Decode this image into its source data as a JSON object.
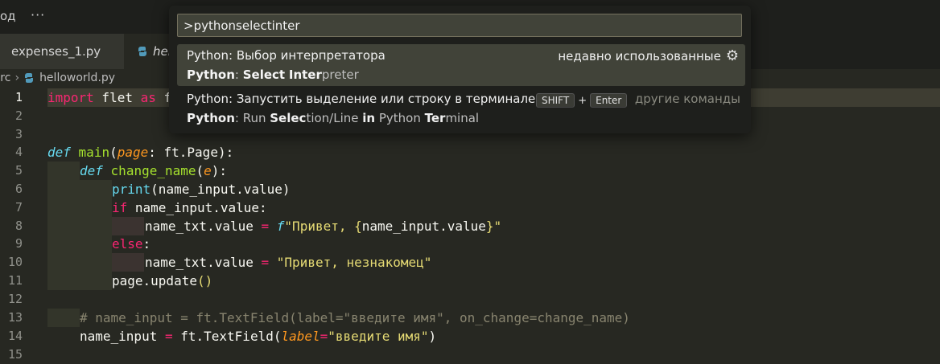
{
  "menubar": {
    "partial_label": "од",
    "more": "···"
  },
  "tabs": [
    {
      "label": "expenses_1.py"
    },
    {
      "label": "hel"
    }
  ],
  "breadcrumb": {
    "folder": "src",
    "file": "helloworld.py"
  },
  "editor": {
    "lines": [
      {
        "n": "1"
      },
      {
        "n": "2"
      },
      {
        "n": "3"
      },
      {
        "n": "4"
      },
      {
        "n": "5"
      },
      {
        "n": "6"
      },
      {
        "n": "7"
      },
      {
        "n": "8"
      },
      {
        "n": "9"
      },
      {
        "n": "10"
      },
      {
        "n": "11"
      },
      {
        "n": "12"
      },
      {
        "n": "13"
      },
      {
        "n": "14"
      },
      {
        "n": "15"
      }
    ],
    "tokens": {
      "l1_import": "import",
      "l1_flet": " flet ",
      "l1_as": "as",
      "l1_rest": " f",
      "l4_def": "def",
      "l4_main": "main",
      "l4_p1": "(",
      "l4_page": "page",
      "l4_p2": ": ft.Page):",
      "l5_def": "def",
      "l5_fn": "change_name",
      "l5_p1": "(",
      "l5_e": "e",
      "l5_p2": "):",
      "l6_print": "print",
      "l6_rest": "(name_input.value)",
      "l7_if": "if",
      "l7_rest": " name_input.value:",
      "l8_a": "name_txt.value ",
      "l8_eq": "=",
      "l8_sp": " ",
      "l8_f": "f",
      "l8_s1": "\"Привет, ",
      "l8_b1": "{",
      "l8_mid": "name_input.value",
      "l8_b2": "}",
      "l8_s2": "\"",
      "l9_else": "else",
      "l9_colon": ":",
      "l10_a": "name_txt.value ",
      "l10_eq": "=",
      "l10_sp": " ",
      "l10_str": "\"Привет, незнакомец\"",
      "l11_a": "page.update",
      "l11_b": "()",
      "l13_comment": "# name_input = ft.TextField(label=\"введите имя\", on_change=change_name)",
      "l14_a": "name_input ",
      "l14_eq": "=",
      "l14_b": " ft.TextField(",
      "l14_label": "label",
      "l14_eq2": "=",
      "l14_str": "\"введите имя\"",
      "l14_c": ")"
    }
  },
  "palette": {
    "input_value": ">pythonselectinter",
    "items": [
      {
        "title": "Python: Выбор интерпретатора",
        "right": "недавно использованные",
        "sub_parts": [
          "Python",
          ": ",
          "Select",
          " ",
          "Inter",
          "preter"
        ]
      },
      {
        "title": "Python: Запустить выделение или строку в терминале ...",
        "keys": [
          "SHIFT",
          "+",
          "Enter"
        ],
        "right": "другие команды",
        "sub_parts": [
          "Python",
          ": Run ",
          "Selec",
          "tion/Line ",
          "in",
          " Python ",
          "Ter",
          "minal"
        ]
      }
    ]
  },
  "icons": {
    "python": "python-file-icon",
    "gear": "gear-icon",
    "chevron": "chevron-right-icon"
  }
}
